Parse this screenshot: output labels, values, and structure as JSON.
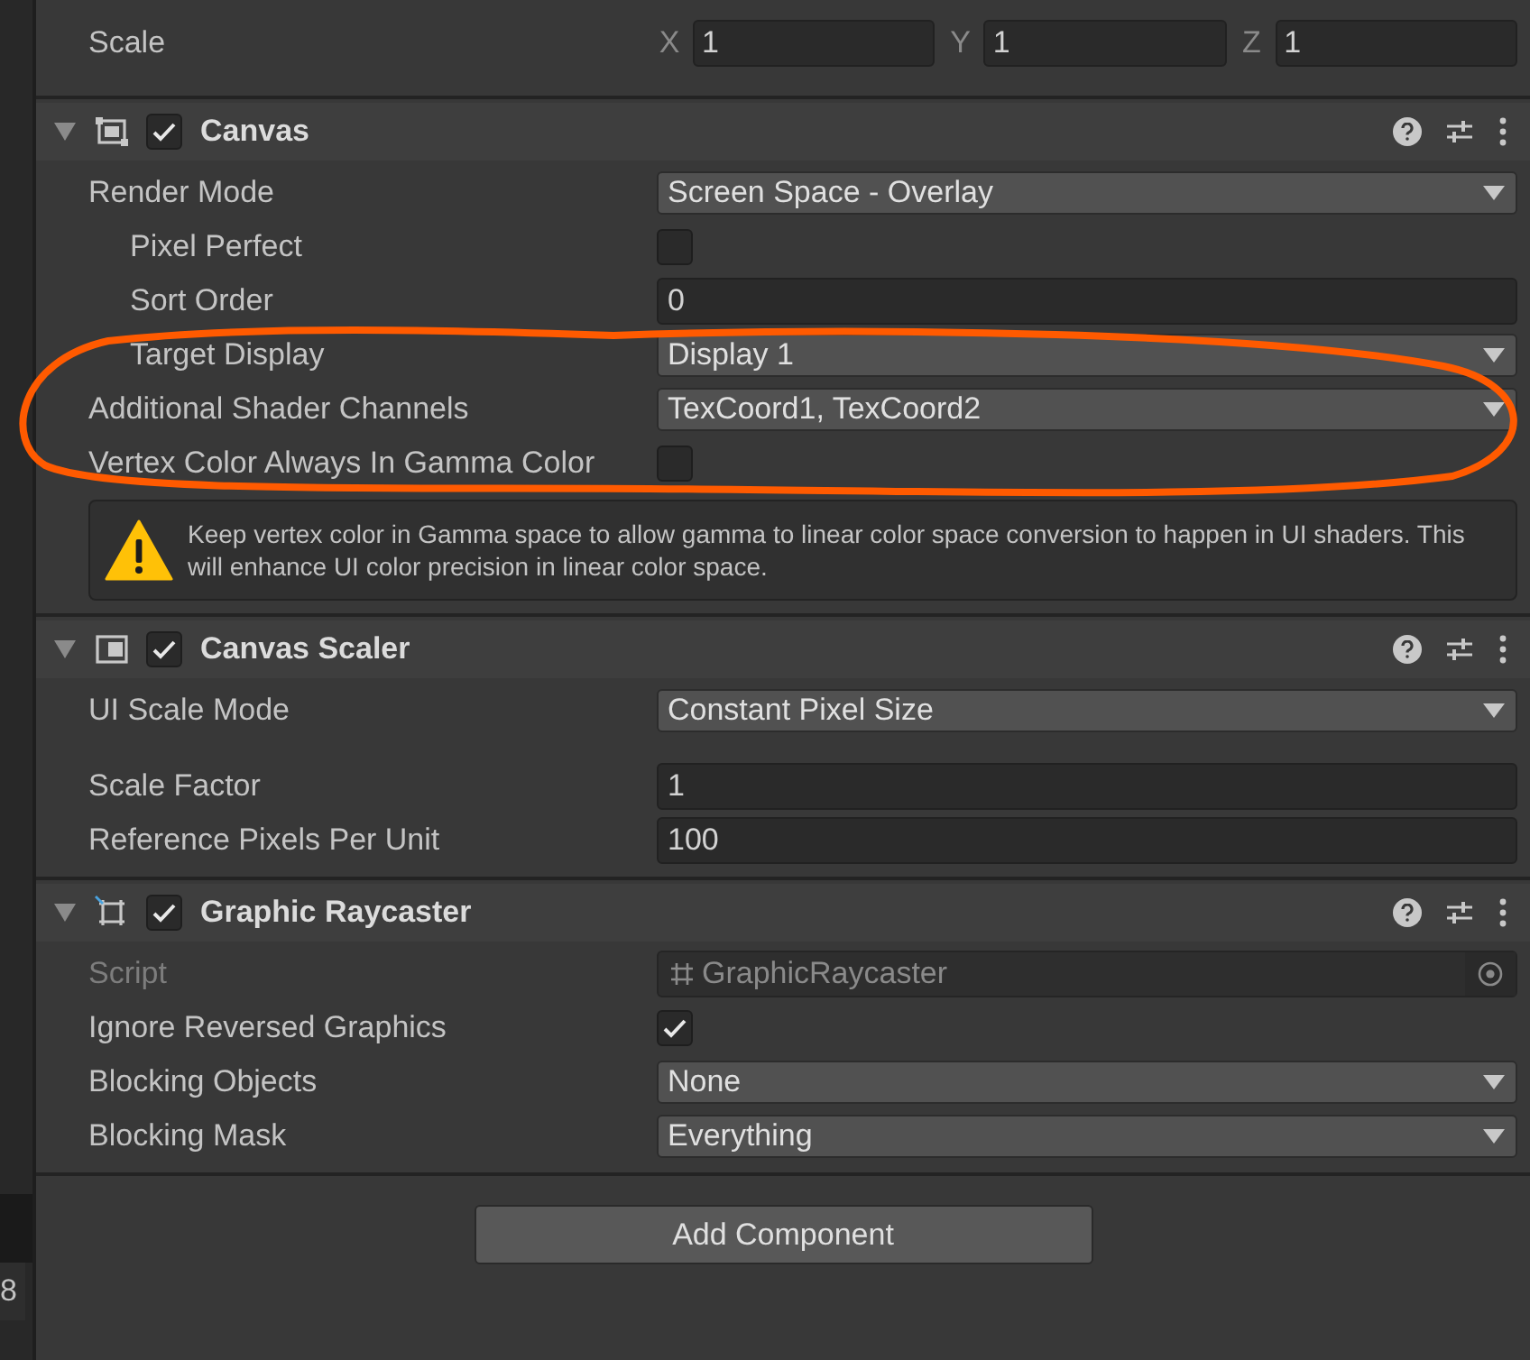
{
  "side_strip": {
    "text": "8"
  },
  "transform": {
    "label": "Scale",
    "axes": [
      {
        "axis": "X",
        "value": "1"
      },
      {
        "axis": "Y",
        "value": "1"
      },
      {
        "axis": "Z",
        "value": "1"
      }
    ]
  },
  "components": [
    {
      "title": "Canvas",
      "kind": "canvas",
      "enabled": true,
      "expanded": true,
      "fields": [
        {
          "kind": "dropdown",
          "label": "Render Mode",
          "value": "Screen Space - Overlay",
          "disabled": false,
          "children": [
            {
              "kind": "checkbox",
              "label": "Pixel Perfect",
              "checked": false,
              "disabled": false
            },
            {
              "kind": "text",
              "label": "Sort Order",
              "value": "0",
              "disabled": false
            },
            {
              "kind": "dropdown",
              "label": "Target Display",
              "value": "Display 1",
              "disabled": false
            }
          ]
        },
        {
          "kind": "dropdown",
          "label": "Additional Shader Channels",
          "value": "TexCoord1, TexCoord2",
          "disabled": false
        },
        {
          "kind": "checkbox",
          "label": "Vertex Color Always In Gamma Color",
          "checked": false,
          "disabled": false
        },
        {
          "kind": "warning",
          "text": "Keep vertex color in Gamma space to allow gamma to linear color space conversion to happen in UI shaders. This will enhance UI color precision in linear color space."
        }
      ]
    },
    {
      "title": "Canvas Scaler",
      "kind": "scaler",
      "enabled": true,
      "expanded": true,
      "fields": [
        {
          "kind": "dropdown",
          "label": "UI Scale Mode",
          "value": "Constant Pixel Size",
          "disabled": false
        },
        {
          "kind": "space"
        },
        {
          "kind": "text",
          "label": "Scale Factor",
          "value": "1",
          "disabled": false
        },
        {
          "kind": "text",
          "label": "Reference Pixels Per Unit",
          "value": "100",
          "disabled": false
        }
      ]
    },
    {
      "title": "Graphic Raycaster",
      "kind": "raycaster",
      "enabled": true,
      "expanded": true,
      "fields": [
        {
          "kind": "objectref",
          "label": "Script",
          "value": "GraphicRaycaster",
          "disabled": true
        },
        {
          "kind": "checkbox",
          "label": "Ignore Reversed Graphics",
          "checked": true,
          "disabled": false
        },
        {
          "kind": "dropdown",
          "label": "Blocking Objects",
          "value": "None",
          "disabled": false
        },
        {
          "kind": "dropdown",
          "label": "Blocking Mask",
          "value": "Everything",
          "disabled": false
        }
      ]
    }
  ],
  "add_component_button": "Add Component",
  "annotation": {
    "kind": "ellipse",
    "color": "#ff5a00"
  }
}
